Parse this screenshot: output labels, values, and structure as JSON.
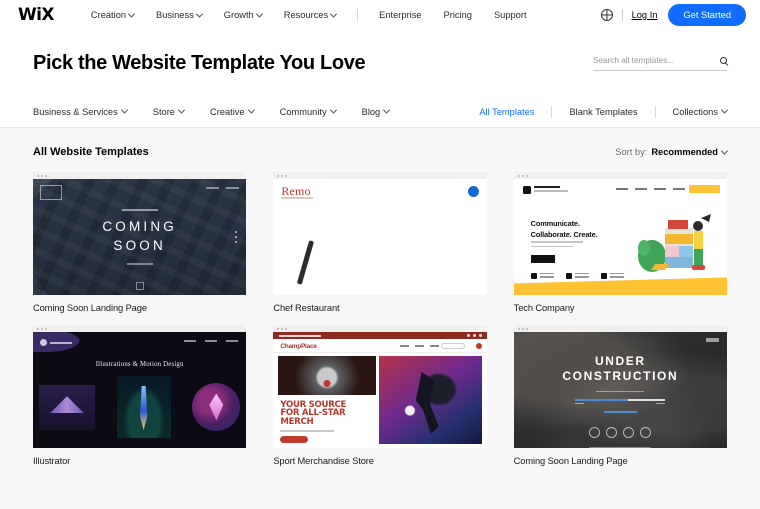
{
  "header": {
    "logo": "WiX",
    "nav": [
      {
        "label": "Creation",
        "caret": true
      },
      {
        "label": "Business",
        "caret": true
      },
      {
        "label": "Growth",
        "caret": true
      },
      {
        "label": "Resources",
        "caret": true
      }
    ],
    "nav_right": [
      {
        "label": "Enterprise",
        "caret": false
      },
      {
        "label": "Pricing",
        "caret": false
      },
      {
        "label": "Support",
        "caret": false
      }
    ],
    "globe_icon": "globe-icon",
    "login": "Log In",
    "get_started": "Get Started",
    "accent_color": "#116DFF"
  },
  "title_bar": {
    "title": "Pick the Website Template You Love",
    "search_placeholder": "Search all templates...",
    "search_value": "",
    "search_icon": "search-icon"
  },
  "category_nav": {
    "left": [
      {
        "label": "Business & Services",
        "caret": true
      },
      {
        "label": "Store",
        "caret": true
      },
      {
        "label": "Creative",
        "caret": true
      },
      {
        "label": "Community",
        "caret": true
      },
      {
        "label": "Blog",
        "caret": true
      }
    ],
    "right": [
      {
        "label": "All Templates",
        "caret": false,
        "active": true
      },
      {
        "label": "Blank Templates",
        "caret": false,
        "active": false
      },
      {
        "label": "Collections",
        "caret": true,
        "active": false
      }
    ]
  },
  "main": {
    "section_title": "All Website Templates",
    "sort_label": "Sort by:",
    "sort_value": "Recommended",
    "templates": [
      {
        "caption": "Coming Soon Landing Page",
        "preview_heading": "COMING\nSOON",
        "preview_line1": "COMING",
        "preview_line2": "SOON"
      },
      {
        "caption": "Chef Restaurant",
        "brand": "Remo"
      },
      {
        "caption": "Tech Company",
        "headline_line1": "Communicate.",
        "headline_line2": "Collaborate. Create."
      },
      {
        "caption": "Illustrator",
        "preview_heading": "Illustrations & Motion Design"
      },
      {
        "caption": "Sport Merchandise Store",
        "brand": "ChampPlace",
        "headline_line1": "YOUR SOURCE",
        "headline_line2": "FOR ALL-STAR",
        "headline_line3": "MERCH"
      },
      {
        "caption": "Coming Soon Landing Page",
        "preview_line1": "UNDER",
        "preview_line2": "CONSTRUCTION"
      }
    ]
  }
}
